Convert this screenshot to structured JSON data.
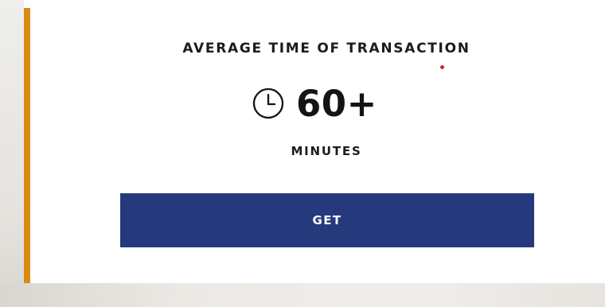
{
  "card": {
    "title": "AVERAGE TIME OF TRANSACTION",
    "value": "60+",
    "unit": "MINUTES",
    "icon": "clock-icon"
  },
  "button": {
    "label": "GET"
  },
  "colors": {
    "accent": "#d98b16",
    "button": "#253a7c",
    "button_text": "#ffffff",
    "text": "#1c1c1c",
    "dot": "#d9242f"
  }
}
